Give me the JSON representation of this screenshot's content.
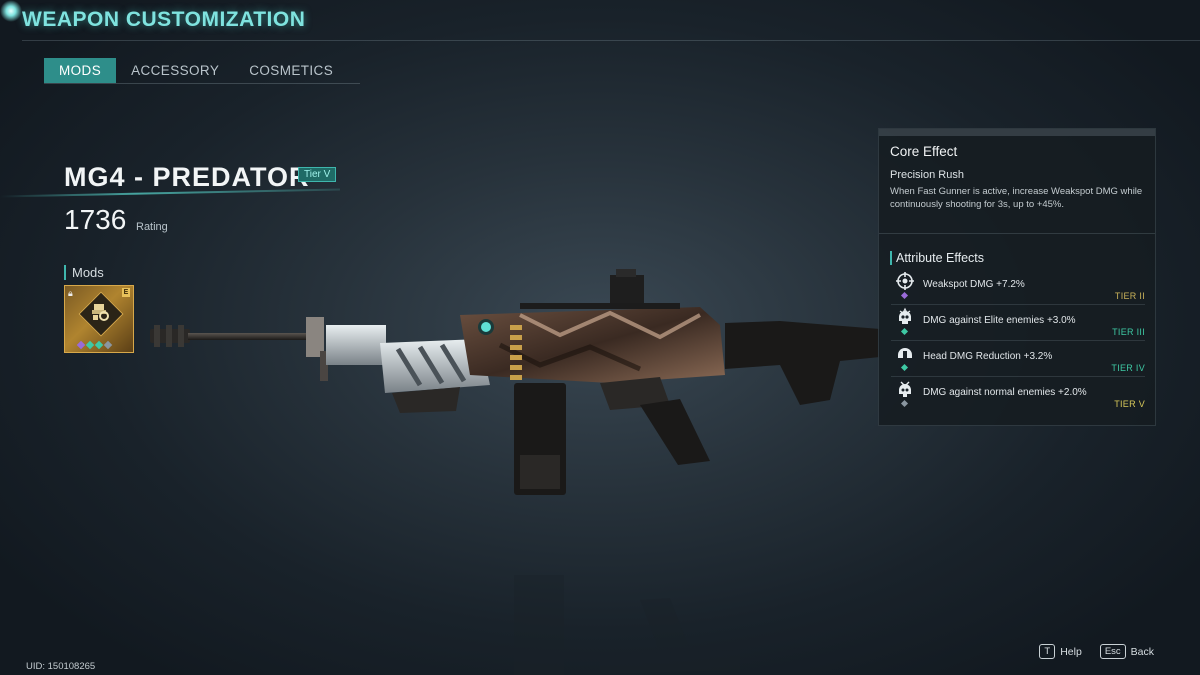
{
  "header": {
    "title": "WEAPON CUSTOMIZATION"
  },
  "tabs": [
    {
      "label": "MODS",
      "active": true
    },
    {
      "label": "ACCESSORY",
      "active": false
    },
    {
      "label": "COSMETICS",
      "active": false
    }
  ],
  "weapon": {
    "name": "MG4 - PREDATOR",
    "tier_badge": "Tier V",
    "rating_value": "1736",
    "rating_label": "Rating"
  },
  "mods": {
    "label": "Mods",
    "card": {
      "tier_letter": "E",
      "gem_colors": [
        "#9a6bd8",
        "#3ec9a4",
        "#3ec9a4",
        "#8a96a0"
      ]
    }
  },
  "core_effect": {
    "title": "Core Effect",
    "name": "Precision Rush",
    "description": "When Fast Gunner is active, increase Weakspot DMG while continuously shooting for 3s, up to +45%."
  },
  "attribute_effects": {
    "title": "Attribute Effects",
    "items": [
      {
        "text": "Weakspot DMG +7.2%",
        "tier": "TIER II",
        "tier_color": "#c9b25a",
        "gem_color": "#9a6bd8",
        "icon": "crosshair-skull-icon"
      },
      {
        "text": "DMG against Elite enemies +3.0%",
        "tier": "TIER III",
        "tier_color": "#3ec9a4",
        "gem_color": "#3ec9a4",
        "icon": "elite-skull-icon"
      },
      {
        "text": "Head DMG Reduction +3.2%",
        "tier": "TIER IV",
        "tier_color": "#3ec9a4",
        "gem_color": "#3ec9a4",
        "icon": "helmet-icon"
      },
      {
        "text": "DMG against normal enemies +2.0%",
        "tier": "TIER V",
        "tier_color": "#d8c95a",
        "gem_color": "#8a96a0",
        "icon": "normal-enemy-icon"
      }
    ]
  },
  "footer": {
    "uid": "UID: 150108265",
    "help_key": "T",
    "help_label": "Help",
    "back_key": "Esc",
    "back_label": "Back"
  },
  "colors": {
    "accent": "#3fb6ad",
    "header_text": "#7fe3df",
    "tab_active_bg": "#2e8e8a"
  }
}
